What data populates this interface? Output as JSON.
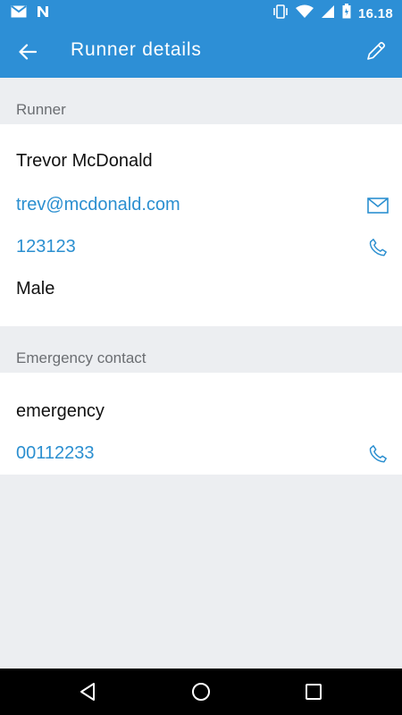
{
  "status_bar": {
    "time": "16.18",
    "icons": [
      "gmail-icon",
      "n-icon",
      "vibrate-icon",
      "wifi-icon",
      "signal-icon",
      "battery-icon"
    ]
  },
  "app_bar": {
    "title": "Runner details",
    "back_icon": "arrow-back-icon",
    "edit_icon": "pencil-icon"
  },
  "runner_section": {
    "header": "Runner",
    "name": "Trevor McDonald",
    "email": "trev@mcdonald.com",
    "phone": "123123",
    "gender": "Male"
  },
  "emergency_section": {
    "header": "Emergency contact",
    "name": "emergency",
    "phone": "00112233"
  },
  "colors": {
    "primary": "#2d8fd6",
    "link": "#2b8fd0",
    "background": "#eceef1",
    "card": "#ffffff",
    "section_text": "#6b6e72"
  },
  "nav_bar": {
    "icons": [
      "back-triangle-icon",
      "home-circle-icon",
      "recents-square-icon"
    ]
  }
}
